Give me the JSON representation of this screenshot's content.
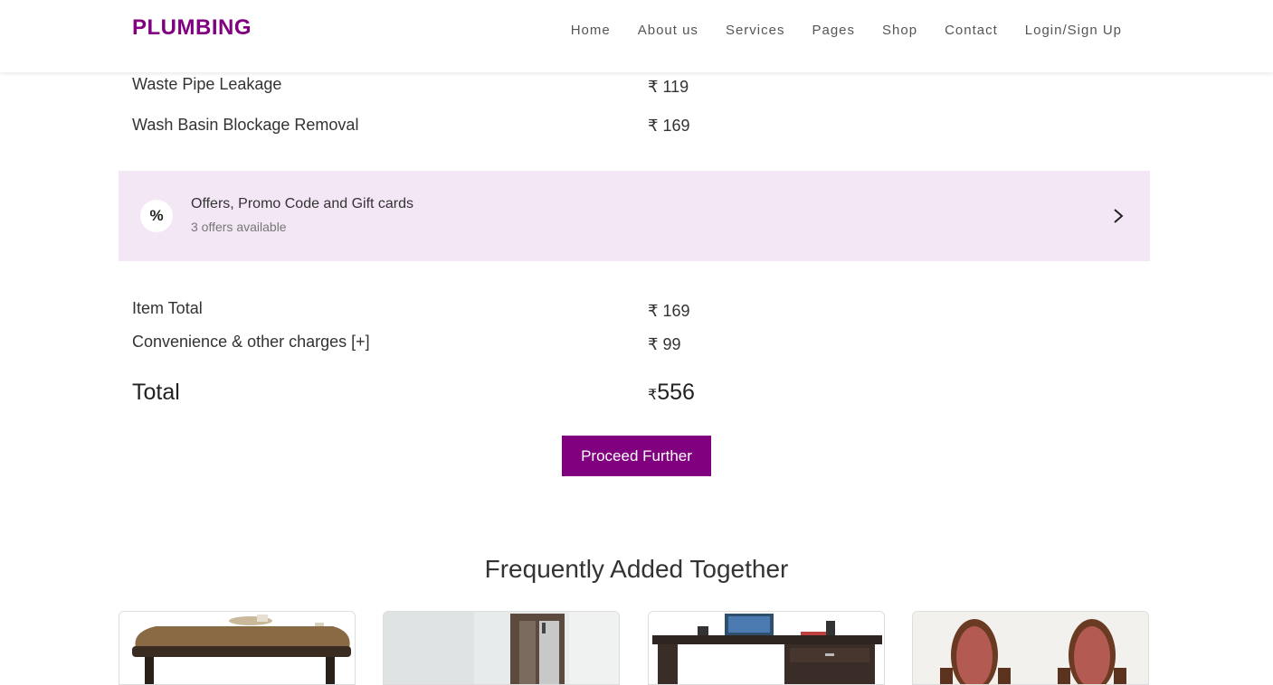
{
  "header": {
    "brand": "PLUMBING",
    "nav": [
      "Home",
      "About us",
      "Services",
      "Pages",
      "Shop",
      "Contact",
      "Login/Sign Up"
    ]
  },
  "items": [
    {
      "name": "Waste Pipe Leakage",
      "price": "₹ 119"
    },
    {
      "name": "Wash Basin Blockage Removal",
      "price": "₹ 169"
    }
  ],
  "offers": {
    "icon": "percent-icon",
    "title": "Offers, Promo Code and Gift cards",
    "subtitle": "3 offers available"
  },
  "summary": {
    "item_total_label": "Item Total",
    "item_total_value": "₹ 169",
    "convenience_label": "Convenience & other charges [+]",
    "convenience_value": "₹ 99",
    "total_label": "Total",
    "total_currency": "₹",
    "total_value": "556"
  },
  "proceed_label": "Proceed Further",
  "frequently": {
    "title": "Frequently Added Together",
    "cards": [
      "wooden-table-image",
      "cabinet-image",
      "office-desk-image",
      "armchairs-image"
    ]
  },
  "colors": {
    "brand": "#800080",
    "offer_bg": "#f3e6f5"
  }
}
